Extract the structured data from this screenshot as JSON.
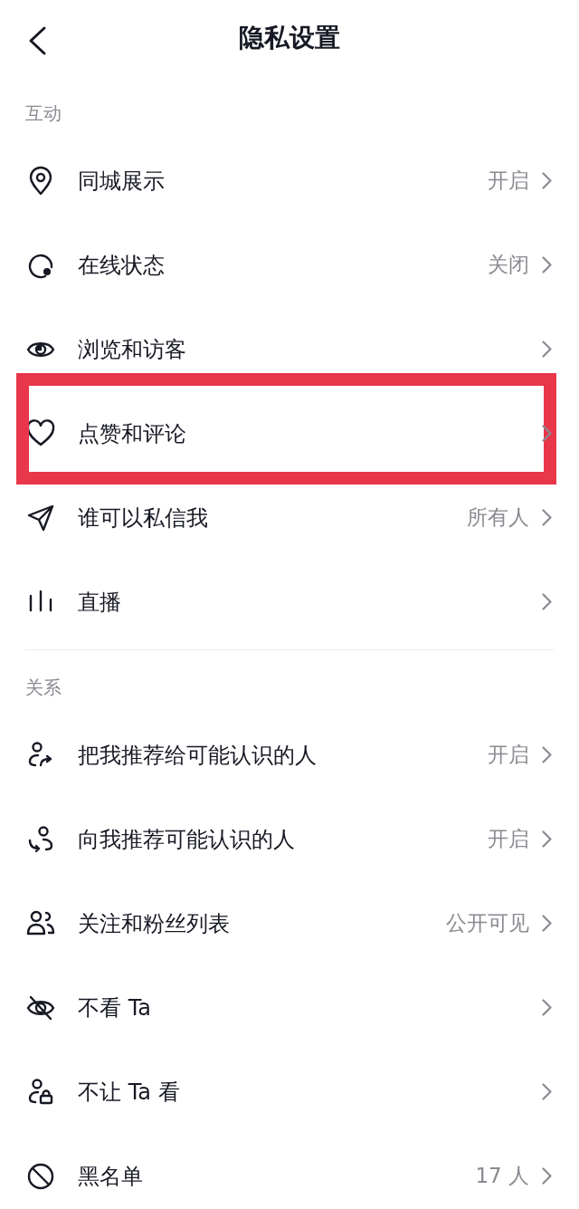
{
  "header": {
    "title": "隐私设置"
  },
  "sections": [
    {
      "label": "互动",
      "items": [
        {
          "label": "同城展示",
          "value": "开启",
          "highlighted": false
        },
        {
          "label": "在线状态",
          "value": "关闭",
          "highlighted": false
        },
        {
          "label": "浏览和访客",
          "highlighted": false
        },
        {
          "label": "点赞和评论",
          "highlighted": true
        },
        {
          "label": "谁可以私信我",
          "value": "所有人",
          "highlighted": false
        },
        {
          "label": "直播",
          "highlighted": false
        }
      ]
    },
    {
      "label": "关系",
      "items": [
        {
          "label": "把我推荐给可能认识的人",
          "value": "开启",
          "highlighted": false
        },
        {
          "label": "向我推荐可能认识的人",
          "value": "开启",
          "highlighted": false
        },
        {
          "label": "关注和粉丝列表",
          "value": "公开可见",
          "highlighted": false
        },
        {
          "label": "不看 Ta",
          "highlighted": false
        },
        {
          "label": "不让 Ta 看",
          "highlighted": false
        },
        {
          "label": "黑名单",
          "value": "17 人",
          "highlighted": false
        }
      ]
    }
  ]
}
